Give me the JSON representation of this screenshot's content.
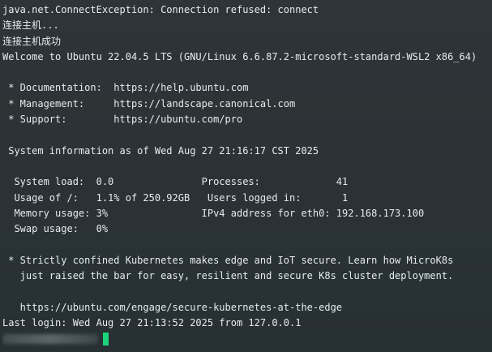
{
  "terminal": {
    "lines": [
      "java.net.ConnectException: Connection refused: connect",
      "连接主机...",
      "连接主机成功",
      "Welcome to Ubuntu 22.04.5 LTS (GNU/Linux 6.6.87.2-microsoft-standard-WSL2 x86_64)",
      "",
      " * Documentation:  https://help.ubuntu.com",
      " * Management:     https://landscape.canonical.com",
      " * Support:        https://ubuntu.com/pro",
      "",
      " System information as of Wed Aug 27 21:16:17 CST 2025",
      "",
      "  System load:  0.0               Processes:             41",
      "  Usage of /:   1.1% of 250.92GB   Users logged in:       1",
      "  Memory usage: 3%                IPv4 address for eth0: 192.168.173.100",
      "  Swap usage:   0%",
      "",
      " * Strictly confined Kubernetes makes edge and IoT secure. Learn how MicroK8s",
      "   just raised the bar for easy, resilient and secure K8s cluster deployment.",
      "",
      "   https://ubuntu.com/engage/secure-kubernetes-at-the-edge",
      "Last login: Wed Aug 27 21:13:52 2025 from 127.0.0.1"
    ],
    "cursor_color": "#1ed47a"
  }
}
